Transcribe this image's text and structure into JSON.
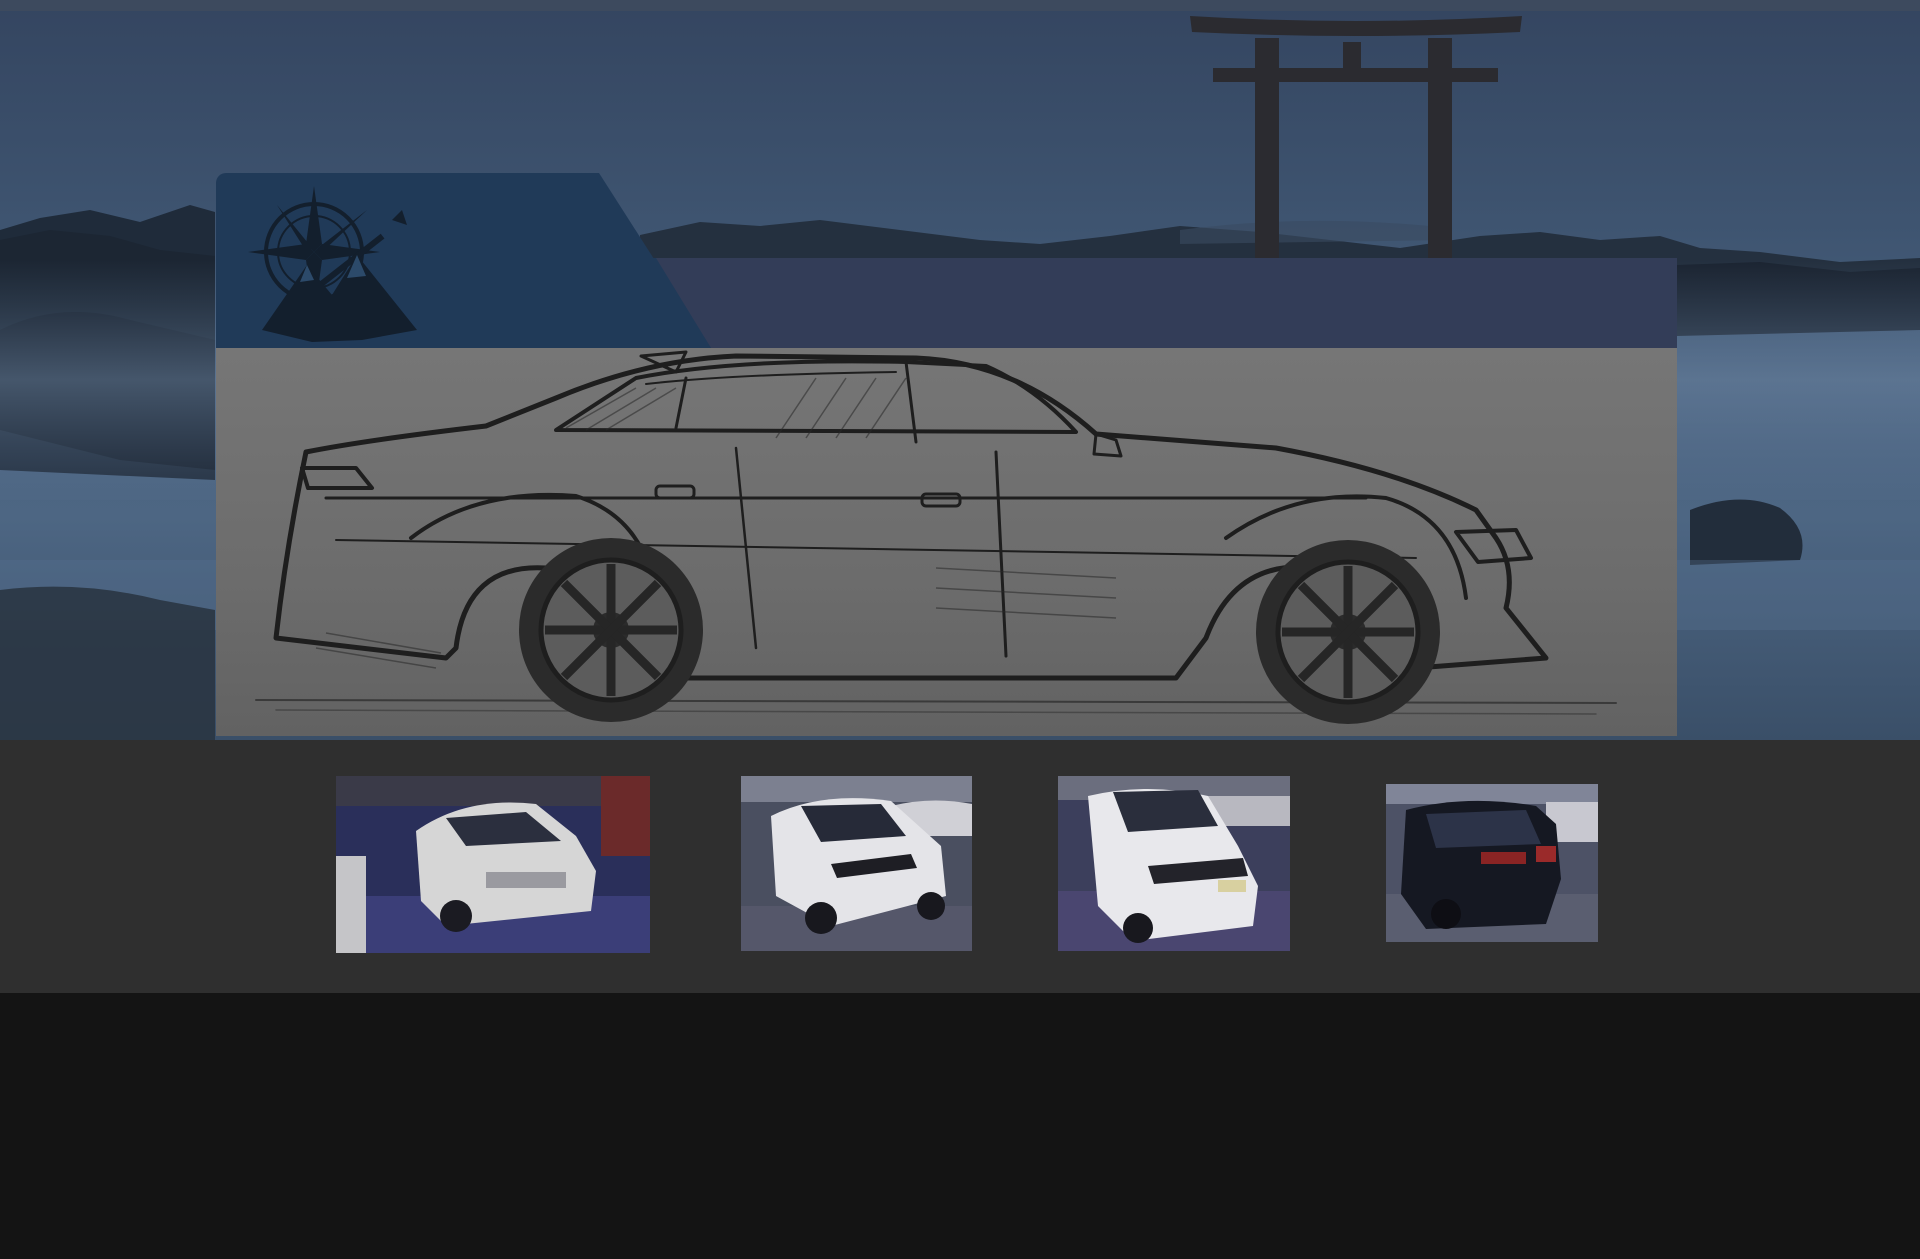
{
  "hero": {
    "background": "misty-sea-with-torii-gate",
    "accent_colors": {
      "panel": "#203a58",
      "navbar": "#333d58",
      "sky": "#3e5470"
    }
  },
  "header": {
    "logo_icon": "compass-mountain-logo-icon"
  },
  "sketch": {
    "subject": "car-sketch-illustration"
  },
  "gallery": {
    "items": [
      {
        "icon": "white-hatchback-photo"
      },
      {
        "icon": "white-compact-suv-photo"
      },
      {
        "icon": "white-minivan-photo"
      },
      {
        "icon": "dark-suv-rear-photo"
      }
    ]
  }
}
